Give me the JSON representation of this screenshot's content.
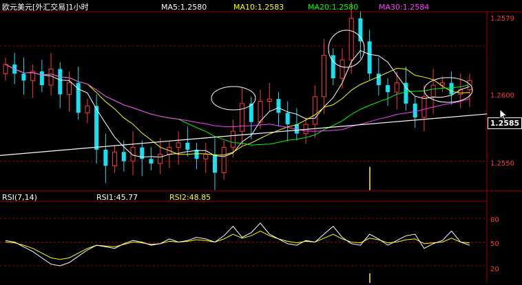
{
  "header": {
    "title": "欧元美元[外汇交易]1小时",
    "ma5": "MA5:1.2580",
    "ma10": "MA10:1.2583",
    "ma20": "MA20:1.2580",
    "ma30": "MA30:1.2584"
  },
  "rsi_header": {
    "title": "RSI(7,14)",
    "rsi1": "RSI1:45.77",
    "rsi2": "RSI2:48.85"
  },
  "price_axis": {
    "top": "1.2579",
    "mid": "1.2600",
    "low": "1.2550",
    "current": "1.2585"
  },
  "rsi_axis": {
    "high": "80",
    "mid": "50",
    "low": "20"
  },
  "colors": {
    "background": "#000000",
    "up_candle": "#ff3b3b",
    "down_candle": "#18e0f0",
    "ma5": "#ffffff",
    "ma10": "#ffff00",
    "ma20": "#00ff00",
    "ma30": "#ff40ff",
    "grid": "#a00000",
    "axis_text": "#ff3b3b"
  },
  "chart_data": {
    "type": "candlestick",
    "series_price_close": [
      1.2592,
      1.2588,
      1.2585,
      1.2589,
      1.2583,
      1.259,
      1.2579,
      1.2584,
      1.2571,
      1.2574,
      1.2555,
      1.2548,
      1.2554,
      1.255,
      1.2556,
      1.2551,
      1.2549,
      1.2553,
      1.2556,
      1.2558,
      1.2555,
      1.2551,
      1.2553,
      1.2545,
      1.2556,
      1.2563,
      1.2575,
      1.2567,
      1.2576,
      1.2577,
      1.2571,
      1.2566,
      1.2562,
      1.2566,
      1.2578,
      1.2596,
      1.2586,
      1.2594,
      1.2612,
      1.2602,
      1.2588,
      1.2583,
      1.258,
      1.2584,
      1.2575,
      1.2569,
      1.2578,
      1.2583,
      1.2584,
      1.2579,
      1.2581,
      1.2585
    ],
    "rsi1": [
      52,
      50,
      44,
      38,
      30,
      22,
      20,
      24,
      32,
      40,
      46,
      44,
      42,
      48,
      52,
      50,
      46,
      48,
      54,
      50,
      52,
      56,
      54,
      50,
      58,
      70,
      56,
      62,
      74,
      60,
      54,
      48,
      46,
      52,
      50,
      60,
      70,
      56,
      48,
      46,
      60,
      54,
      46,
      52,
      58,
      60,
      42,
      48,
      52,
      64,
      50,
      46
    ],
    "rsi2": [
      50,
      49,
      46,
      42,
      36,
      30,
      28,
      30,
      36,
      42,
      46,
      45,
      44,
      47,
      50,
      49,
      47,
      48,
      51,
      50,
      51,
      53,
      52,
      50,
      54,
      60,
      55,
      58,
      64,
      58,
      54,
      51,
      49,
      51,
      50,
      55,
      60,
      54,
      50,
      49,
      55,
      53,
      49,
      50,
      53,
      54,
      48,
      49,
      50,
      55,
      50,
      49
    ],
    "rsi_axis_ticks": [
      80,
      50,
      20
    ]
  }
}
